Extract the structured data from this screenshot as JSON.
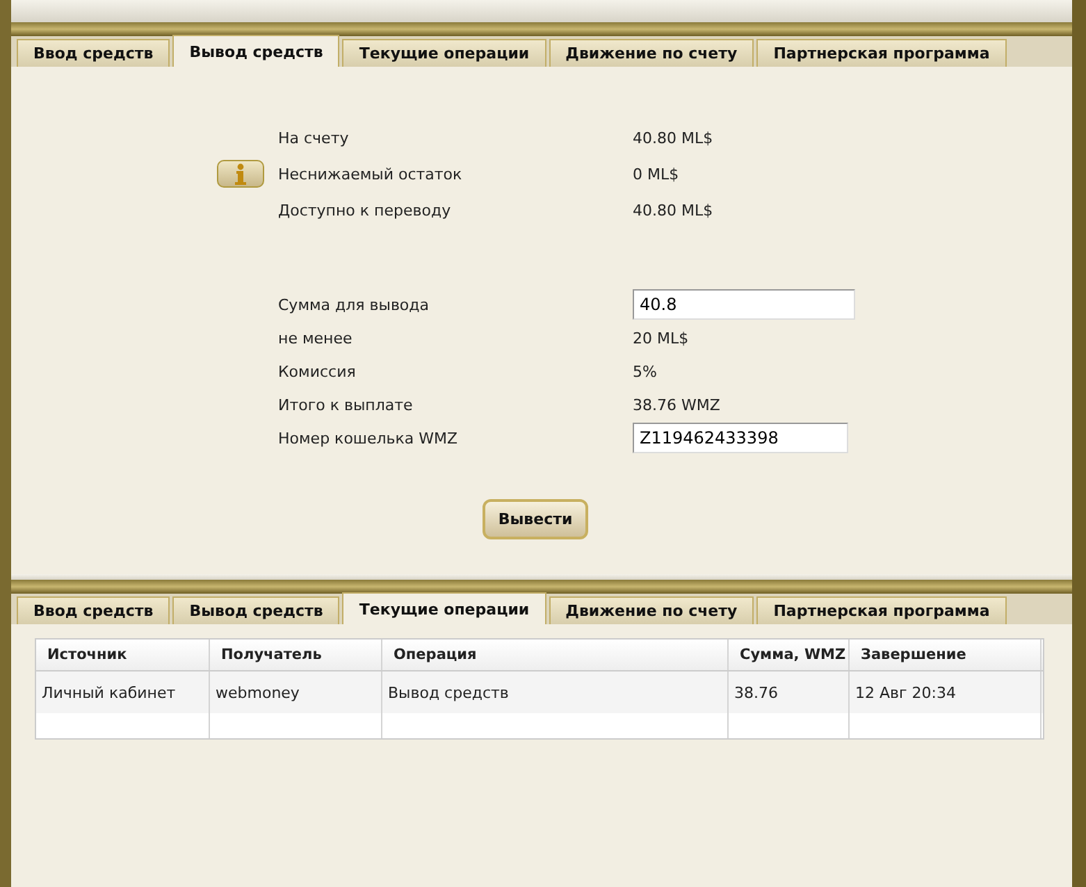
{
  "panels": [
    {
      "kind": "form",
      "tabs": [
        {
          "label": "Ввод средств",
          "selected": false
        },
        {
          "label": "Вывод средств",
          "selected": true
        },
        {
          "label": "Текущие операции",
          "selected": false
        },
        {
          "label": "Движение по счету",
          "selected": false
        },
        {
          "label": "Партнерская программа",
          "selected": false
        }
      ],
      "balance": [
        {
          "label": "На счету",
          "value": "40.80 ML$"
        },
        {
          "label": "Неснижаемый остаток",
          "value": "0 ML$",
          "info": true
        },
        {
          "label": "Доступно к переводу",
          "value": "40.80 ML$"
        }
      ],
      "fields": [
        {
          "kind": "input",
          "label": "Сумма для вывода",
          "value": "40.8"
        },
        {
          "kind": "text",
          "label": "не менее",
          "value": "20 ML$"
        },
        {
          "kind": "text",
          "label": "Комиссия",
          "value": "5%"
        },
        {
          "kind": "text",
          "label": "Итого к выплате",
          "value": "38.76 WMZ"
        },
        {
          "kind": "input",
          "label": "Номер кошелька WMZ",
          "value": "Z119462433398"
        }
      ],
      "button": "Вывести"
    },
    {
      "kind": "table",
      "tabs": [
        {
          "label": "Ввод средств",
          "selected": false
        },
        {
          "label": "Вывод средств",
          "selected": false
        },
        {
          "label": "Текущие операции",
          "selected": true
        },
        {
          "label": "Движение по счету",
          "selected": false
        },
        {
          "label": "Партнерская программа",
          "selected": false
        }
      ],
      "table": {
        "columns": [
          "Источник",
          "Получатель",
          "Операция",
          "Сумма, WMZ",
          "Завершение"
        ],
        "rows": [
          [
            "Личный кабинет",
            "webmoney",
            "Вывод средств",
            "38.76",
            "12 Авг 20:34"
          ]
        ]
      }
    }
  ]
}
